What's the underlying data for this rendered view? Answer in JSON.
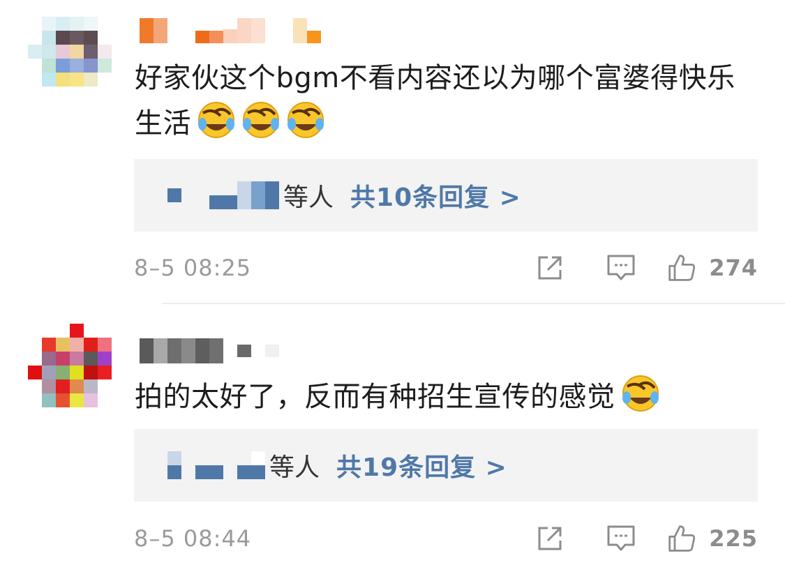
{
  "comments": [
    {
      "text": "好家伙这个bgm不看内容还以为哪个富婆得快乐生活",
      "emoji": "laughing-crying-emoji",
      "emoji_count": 3,
      "reply_summary": {
        "suffix": "等人",
        "count_label": "共10条回复 >"
      },
      "timestamp": "8–5 08:25",
      "likes": "274"
    },
    {
      "text": "拍的太好了，反而有种招生宣传的感觉",
      "emoji": "laughing-crying-emoji",
      "emoji_count": 1,
      "reply_summary": {
        "suffix": "等人",
        "count_label": "共19条回复 >"
      },
      "timestamp": "8–5 08:44",
      "likes": "225"
    }
  ],
  "icons": {
    "share": "share-icon",
    "reply": "comment-icon",
    "like": "thumbs-up-icon"
  },
  "colors": {
    "link_blue": "#4f78a8",
    "meta_gray": "#9a9a9a",
    "reply_bg": "#f3f3f3"
  }
}
